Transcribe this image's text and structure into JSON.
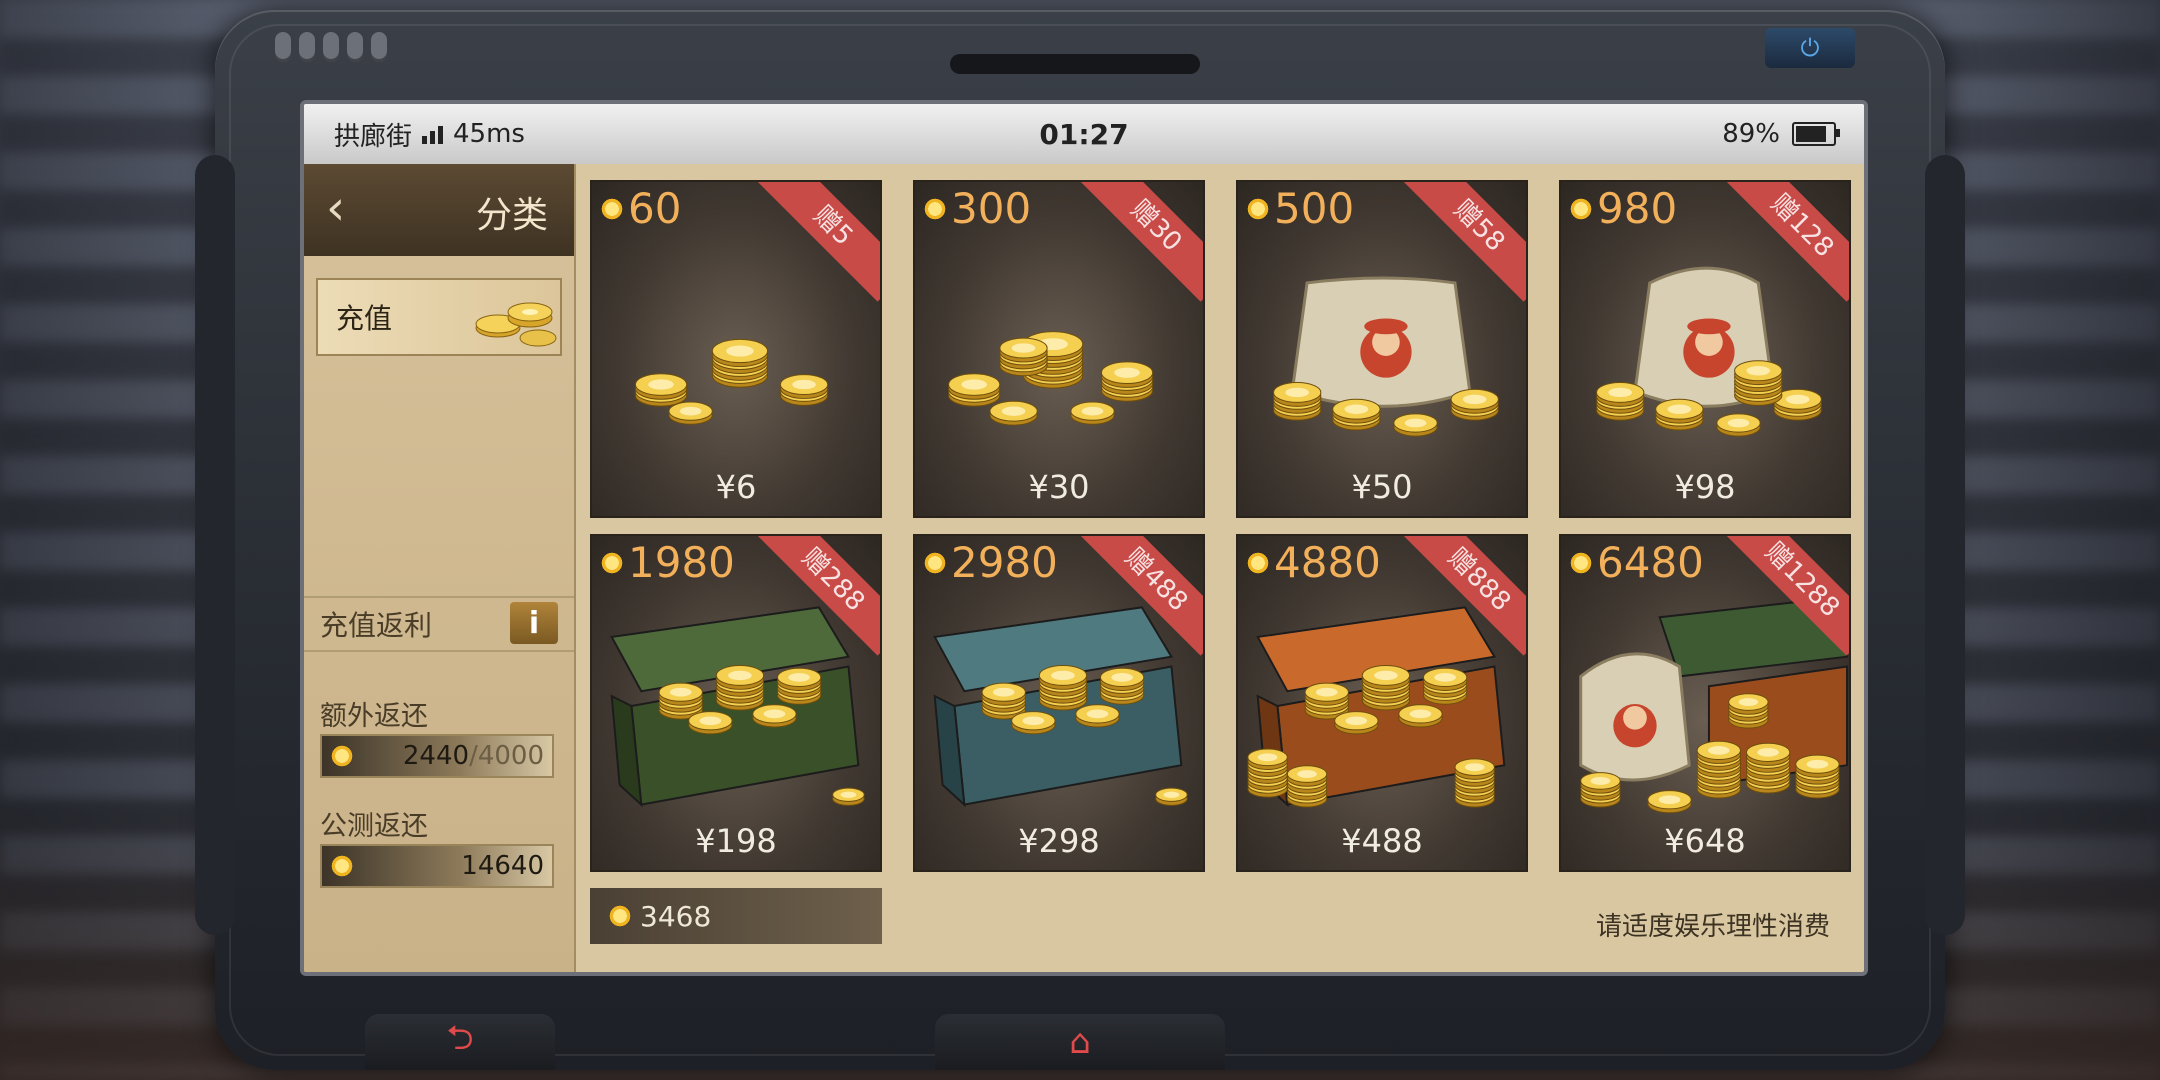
{
  "status": {
    "location": "拱廊街",
    "ping": "45ms",
    "time": "01:27",
    "battery": "89%",
    "battery_level": 0.89
  },
  "sidebar": {
    "title": "分类",
    "active_item": "充值",
    "rebate_title": "充值返利",
    "info_label": "i",
    "extra_label": "额外返还",
    "extra_current": "2440",
    "extra_total": "/4000",
    "beta_label": "公测返还",
    "beta_value": "14640"
  },
  "products": [
    {
      "amount": "60",
      "bonus": "赠5",
      "price": "¥6",
      "art": "small-coins"
    },
    {
      "amount": "300",
      "bonus": "赠30",
      "price": "¥30",
      "art": "coins"
    },
    {
      "amount": "500",
      "bonus": "赠58",
      "price": "¥50",
      "art": "bag"
    },
    {
      "amount": "980",
      "bonus": "赠128",
      "price": "¥98",
      "art": "bag-large"
    },
    {
      "amount": "1980",
      "bonus": "赠288",
      "price": "¥198",
      "art": "green-crate"
    },
    {
      "amount": "2980",
      "bonus": "赠488",
      "price": "¥298",
      "art": "teal-crate"
    },
    {
      "amount": "4880",
      "bonus": "赠888",
      "price": "¥488",
      "art": "orange-crate"
    },
    {
      "amount": "6480",
      "bonus": "赠1288",
      "price": "¥648",
      "art": "mega-pile"
    }
  ],
  "balance": "3468",
  "notice": "请适度娱乐理性消费",
  "icons": {
    "back": "chevron-left-icon",
    "power": "power-icon",
    "return": "return-arrow-icon",
    "home": "home-icon",
    "currency": "sun-coin-icon"
  },
  "colors": {
    "accent": "#f3b05a",
    "ribbon": "#c94b48",
    "panel": "#d9c7a2"
  }
}
